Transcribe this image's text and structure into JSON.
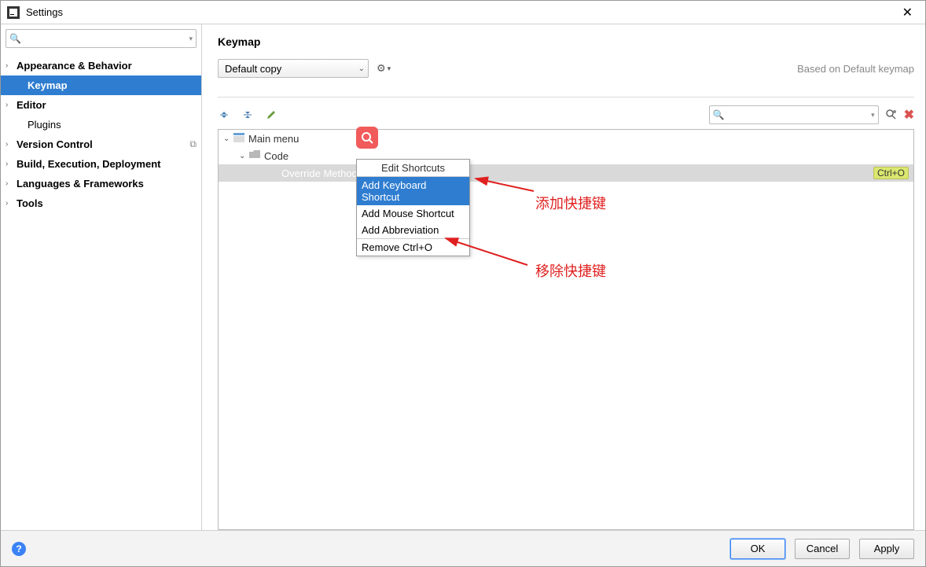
{
  "window": {
    "title": "Settings"
  },
  "sidebar": {
    "search_placeholder": "",
    "items": [
      {
        "label": "Appearance & Behavior",
        "bold": true,
        "chevron": true
      },
      {
        "label": "Keymap",
        "bold": true,
        "selected": true
      },
      {
        "label": "Editor",
        "bold": true,
        "chevron": true
      },
      {
        "label": "Plugins",
        "bold": false
      },
      {
        "label": "Version Control",
        "bold": true,
        "chevron": true,
        "trail": true
      },
      {
        "label": "Build, Execution, Deployment",
        "bold": true,
        "chevron": true
      },
      {
        "label": "Languages & Frameworks",
        "bold": true,
        "chevron": true
      },
      {
        "label": "Tools",
        "bold": true,
        "chevron": true
      }
    ]
  },
  "content": {
    "title": "Keymap",
    "template_value": "Default copy",
    "based_on": "Based on Default keymap",
    "search_placeholder": ""
  },
  "tree": {
    "root": "Main menu",
    "child1": "Code",
    "selected_item": "Override Methods...",
    "selected_shortcut": "Ctrl+O"
  },
  "context_menu": {
    "header": "Edit Shortcuts",
    "item1": "Add Keyboard Shortcut",
    "item2": "Add Mouse Shortcut",
    "item3": "Add Abbreviation",
    "item4": "Remove Ctrl+O"
  },
  "annotations": {
    "text1": "添加快捷键",
    "text2": "移除快捷键"
  },
  "footer": {
    "ok": "OK",
    "cancel": "Cancel",
    "apply": "Apply"
  }
}
